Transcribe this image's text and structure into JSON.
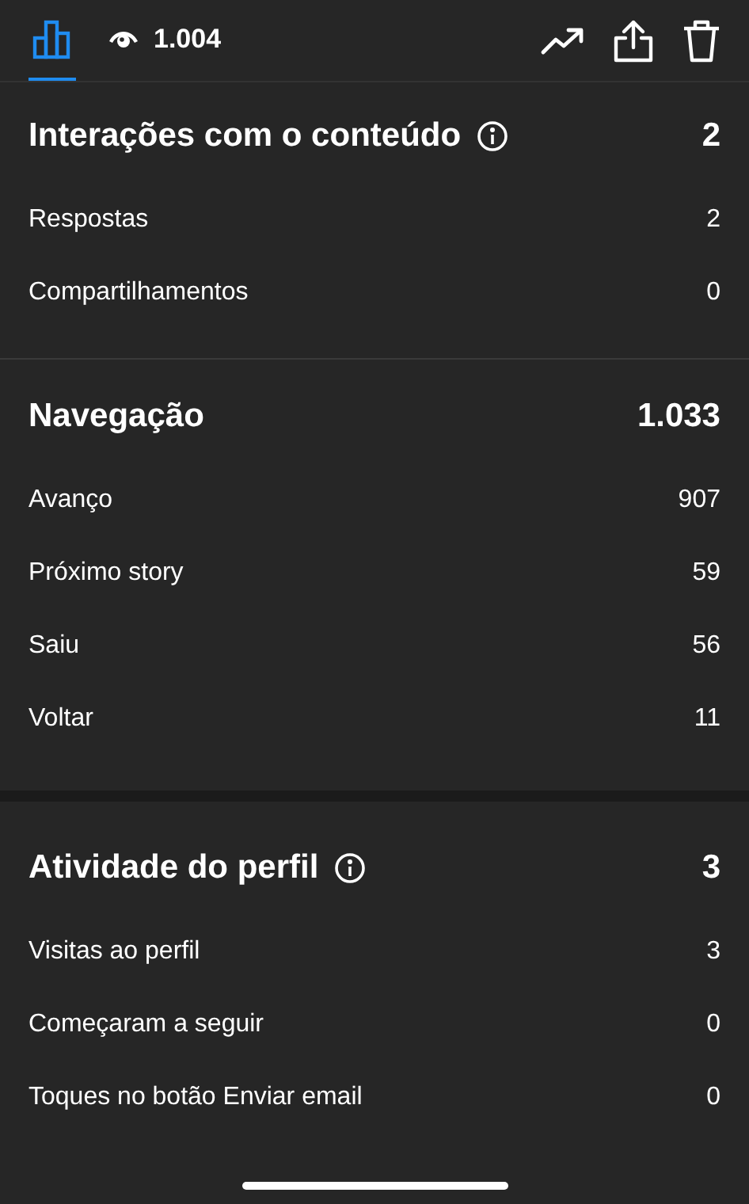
{
  "tabs": [
    {
      "kind": "chart",
      "selected": true
    },
    {
      "kind": "views",
      "label": "1.004",
      "selected": false
    }
  ],
  "groups": [
    {
      "sections": [
        {
          "title": "Interações com o conteúdo",
          "info": true,
          "total": "2",
          "rows": [
            {
              "label": "Respostas",
              "value": "2"
            },
            {
              "label": "Compartilhamentos",
              "value": "0"
            }
          ]
        },
        {
          "title": "Navegação",
          "info": false,
          "total": "1.033",
          "rows": [
            {
              "label": "Avanço",
              "value": "907"
            },
            {
              "label": "Próximo story",
              "value": "59"
            },
            {
              "label": "Saiu",
              "value": "56"
            },
            {
              "label": "Voltar",
              "value": "11"
            }
          ]
        }
      ]
    },
    {
      "sections": [
        {
          "title": "Atividade do perfil",
          "info": true,
          "total": "3",
          "rows": [
            {
              "label": "Visitas ao perfil",
              "value": "3"
            },
            {
              "label": "Começaram a seguir",
              "value": "0"
            },
            {
              "label": "Toques no botão Enviar email",
              "value": "0"
            }
          ]
        }
      ]
    }
  ]
}
